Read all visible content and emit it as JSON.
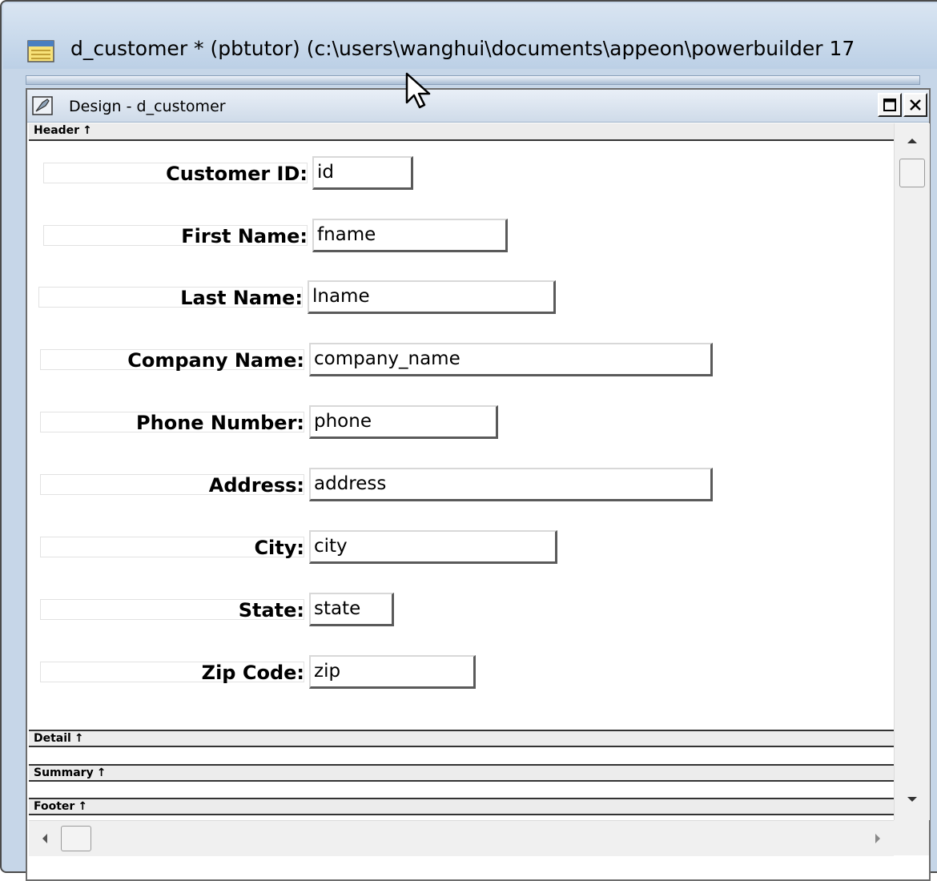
{
  "window": {
    "title": "d_customer * (pbtutor) (c:\\users\\wanghui\\documents\\appeon\\powerbuilder 17"
  },
  "design": {
    "title": "Design - d_customer"
  },
  "bands": {
    "header": "Header",
    "detail": "Detail",
    "summary": "Summary",
    "footer": "Footer",
    "arrow": "↑"
  },
  "fields": [
    {
      "label": "Customer ID:",
      "column": "id"
    },
    {
      "label": "First Name:",
      "column": "fname"
    },
    {
      "label": "Last Name:",
      "column": "lname"
    },
    {
      "label": "Company Name:",
      "column": "company_name"
    },
    {
      "label": "Phone Number:",
      "column": "phone"
    },
    {
      "label": "Address:",
      "column": "address"
    },
    {
      "label": "City:",
      "column": "city"
    },
    {
      "label": "State:",
      "column": "state"
    },
    {
      "label": "Zip Code:",
      "column": "zip"
    }
  ],
  "colors": {
    "title_bar": "#c6d6e8",
    "band_line": "#333333"
  }
}
